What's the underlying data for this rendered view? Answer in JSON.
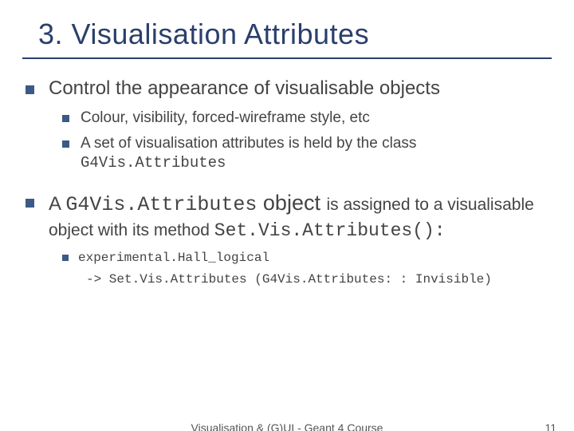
{
  "title": "3. Visualisation Attributes",
  "bullets": {
    "b1a": "Control the appearance of visualisable objects",
    "b2a": "Colour, visibility, forced-wireframe style, etc",
    "b2b_pre": "A set of visualisation attributes is held by the class ",
    "b2b_code": "G4Vis.Attributes",
    "b1b_pre": "A ",
    "b1b_code": "G4Vis.Attributes",
    "b1b_mid": " object ",
    "b1b_post1": "is assigned to a visualisable object with its method ",
    "b1b_code2": "Set.Vis.Attributes():",
    "b3a": "experimental.Hall_logical",
    "b3b": "-> Set.Vis.Attributes (G4Vis.Attributes: : Invisible)"
  },
  "footer": {
    "center": "Visualisation & (G)UI - Geant 4 Course",
    "page": "11"
  }
}
